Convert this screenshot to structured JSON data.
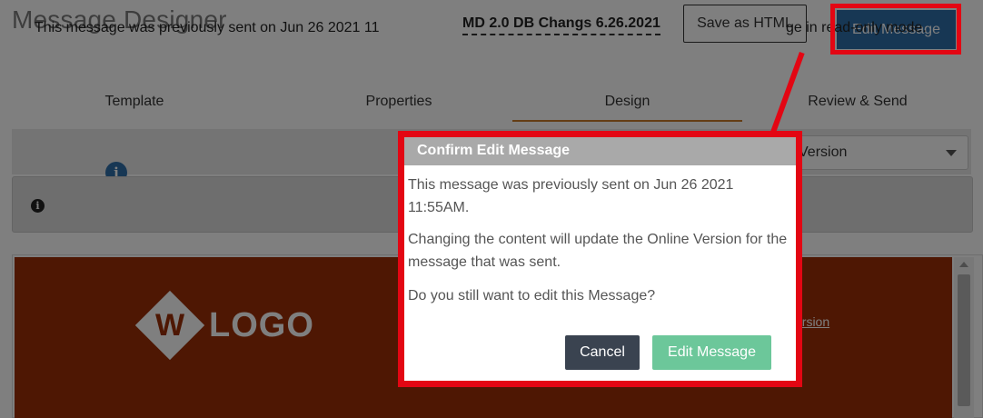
{
  "header": {
    "title": "Message Designer",
    "message_name": "MD 2.0 DB Changs 6.26.2021",
    "save_html_label": "Save as HTML",
    "edit_message_label": "Edit Message"
  },
  "tabs": [
    {
      "label": "Template",
      "active": false
    },
    {
      "label": "Properties",
      "active": false
    },
    {
      "label": "Design",
      "active": true
    },
    {
      "label": "Review & Send",
      "active": false
    }
  ],
  "toolbar": {
    "info_icon": "info-icon",
    "version_select_value": "Version"
  },
  "notice": {
    "icon": "info-circle-icon",
    "text_left": "This message was previously sent on Jun 26 2021 11",
    "text_right": "ge in read-only mode."
  },
  "preview": {
    "logo_text": "LOGO",
    "logo_mark": "W",
    "online_link": "ersion",
    "banner_color": "#9c2f07"
  },
  "modal": {
    "title": "Confirm Edit Message",
    "paragraph_1": "This message was previously sent on Jun 26 2021 11:55AM.",
    "paragraph_2": "Changing the content will update the Online Version for the message that was sent.",
    "paragraph_3": "Do you still want to edit this Message?",
    "cancel_label": "Cancel",
    "confirm_label": "Edit Message"
  },
  "colors": {
    "primary": "#2f6ea8",
    "highlight": "#e30613",
    "confirm": "#6cc79a",
    "cancel": "#3a4350",
    "active_tab": "#c97a2a"
  }
}
